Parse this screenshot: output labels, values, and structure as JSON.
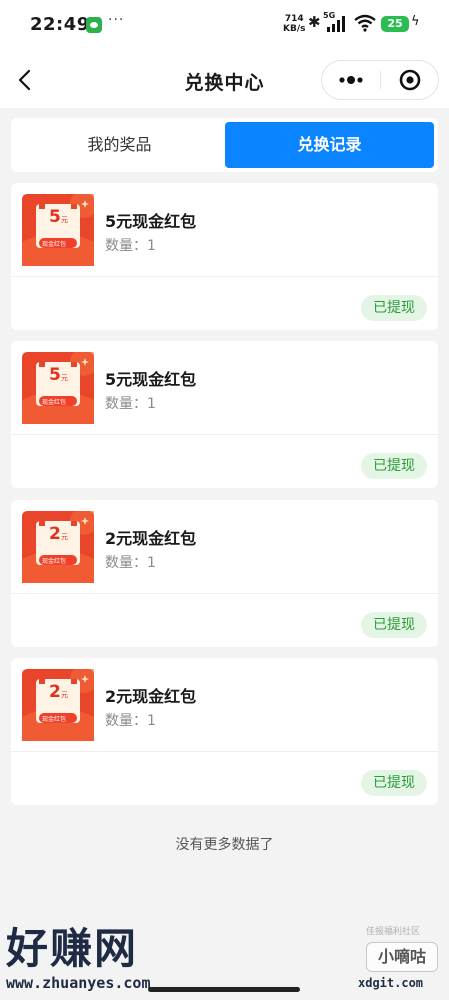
{
  "status_bar": {
    "time": "22:49",
    "more": "···",
    "speed_value": "714",
    "speed_unit": "KB/s",
    "network": "5G",
    "battery": "25"
  },
  "header": {
    "title": "兑换中心",
    "icons": {
      "back": "chevron-left-icon",
      "more": "more-dots-icon",
      "close": "target-close-icon"
    }
  },
  "tabs": [
    {
      "label": "我的奖品",
      "active": false
    },
    {
      "label": "兑换记录",
      "active": true
    }
  ],
  "records": [
    {
      "name": "5元现金红包",
      "qty_label": "数量：1",
      "amount": "5",
      "unit": "元",
      "badge": "现金红包",
      "status": "已提现"
    },
    {
      "name": "5元现金红包",
      "qty_label": "数量：1",
      "amount": "5",
      "unit": "元",
      "badge": "现金红包",
      "status": "已提现"
    },
    {
      "name": "2元现金红包",
      "qty_label": "数量：1",
      "amount": "2",
      "unit": "元",
      "badge": "现金红包",
      "status": "已提现"
    },
    {
      "name": "2元现金红包",
      "qty_label": "数量：1",
      "amount": "2",
      "unit": "元",
      "badge": "现金红包",
      "status": "已提现"
    }
  ],
  "footer_text": "没有更多数据了",
  "watermarks": {
    "left_big": "好赚网",
    "left_url": "www.zhuanyes.com",
    "right_small": "佳报福利社区",
    "right_box": "小嘀咕",
    "right_url": "xdgit.com"
  },
  "colors": {
    "accent": "#0a84ff",
    "status_bg": "#e4f5e6",
    "status_text": "#2a9d3a",
    "envelope_red": "#e8452a"
  }
}
